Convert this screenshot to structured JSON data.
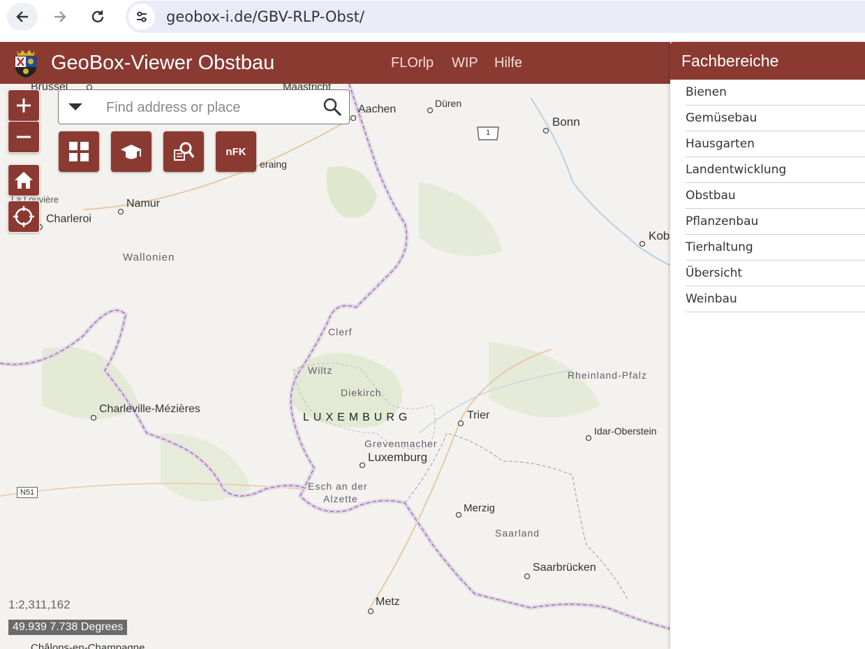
{
  "browser": {
    "url": "geobox-i.de/GBV-RLP-Obst/"
  },
  "app": {
    "title": "GeoBox-Viewer Obstbau",
    "menu": [
      "FLOrlp",
      "WIP",
      "Hilfe"
    ]
  },
  "search": {
    "placeholder": "Find address or place"
  },
  "tools": {
    "nfk_label": "nFK"
  },
  "map": {
    "places": {
      "brussel": "Brussel",
      "maastricht": "Maastricht",
      "aachen": "Aachen",
      "dueren": "Düren",
      "bonn": "Bonn",
      "road_1": "1",
      "eraing": "eraing",
      "namur": "Namur",
      "charleroi": "Charleroi",
      "la_louviere": "La Louvière",
      "wallonien": "Wallonien",
      "kobl": "Kobl",
      "clerf": "Clerf",
      "wiltz": "Wiltz",
      "diekirch": "Diekirch",
      "luxemburg_country": "LUXEMBURG",
      "rheinland_pfalz": "Rheinland-Pfalz",
      "charleville": "Charleville-Mézières",
      "trier": "Trier",
      "idar": "Idar-Oberstein",
      "grevenmacher": "Grevenmacher",
      "luxemburg_city": "Luxemburg",
      "n51": "N51",
      "esch": "Esch an der",
      "alzette": "Alzette",
      "merzig": "Merzig",
      "saarland": "Saarland",
      "saarbruecken": "Saarbrücken",
      "metz": "Metz",
      "chalons": "Châlons-en-Champagne"
    },
    "scale": "1:2,311,162",
    "coordinates": "49.939 7.738 Degrees"
  },
  "panel": {
    "title": "Fachbereiche",
    "items": [
      "Bienen",
      "Gemüsebau",
      "Hausgarten",
      "Landentwicklung",
      "Obstbau",
      "Pflanzenbau",
      "Tierhaltung",
      "Übersicht",
      "Weinbau"
    ]
  },
  "colors": {
    "brand": "#8b3a32",
    "border_line": "#b28fb8"
  }
}
